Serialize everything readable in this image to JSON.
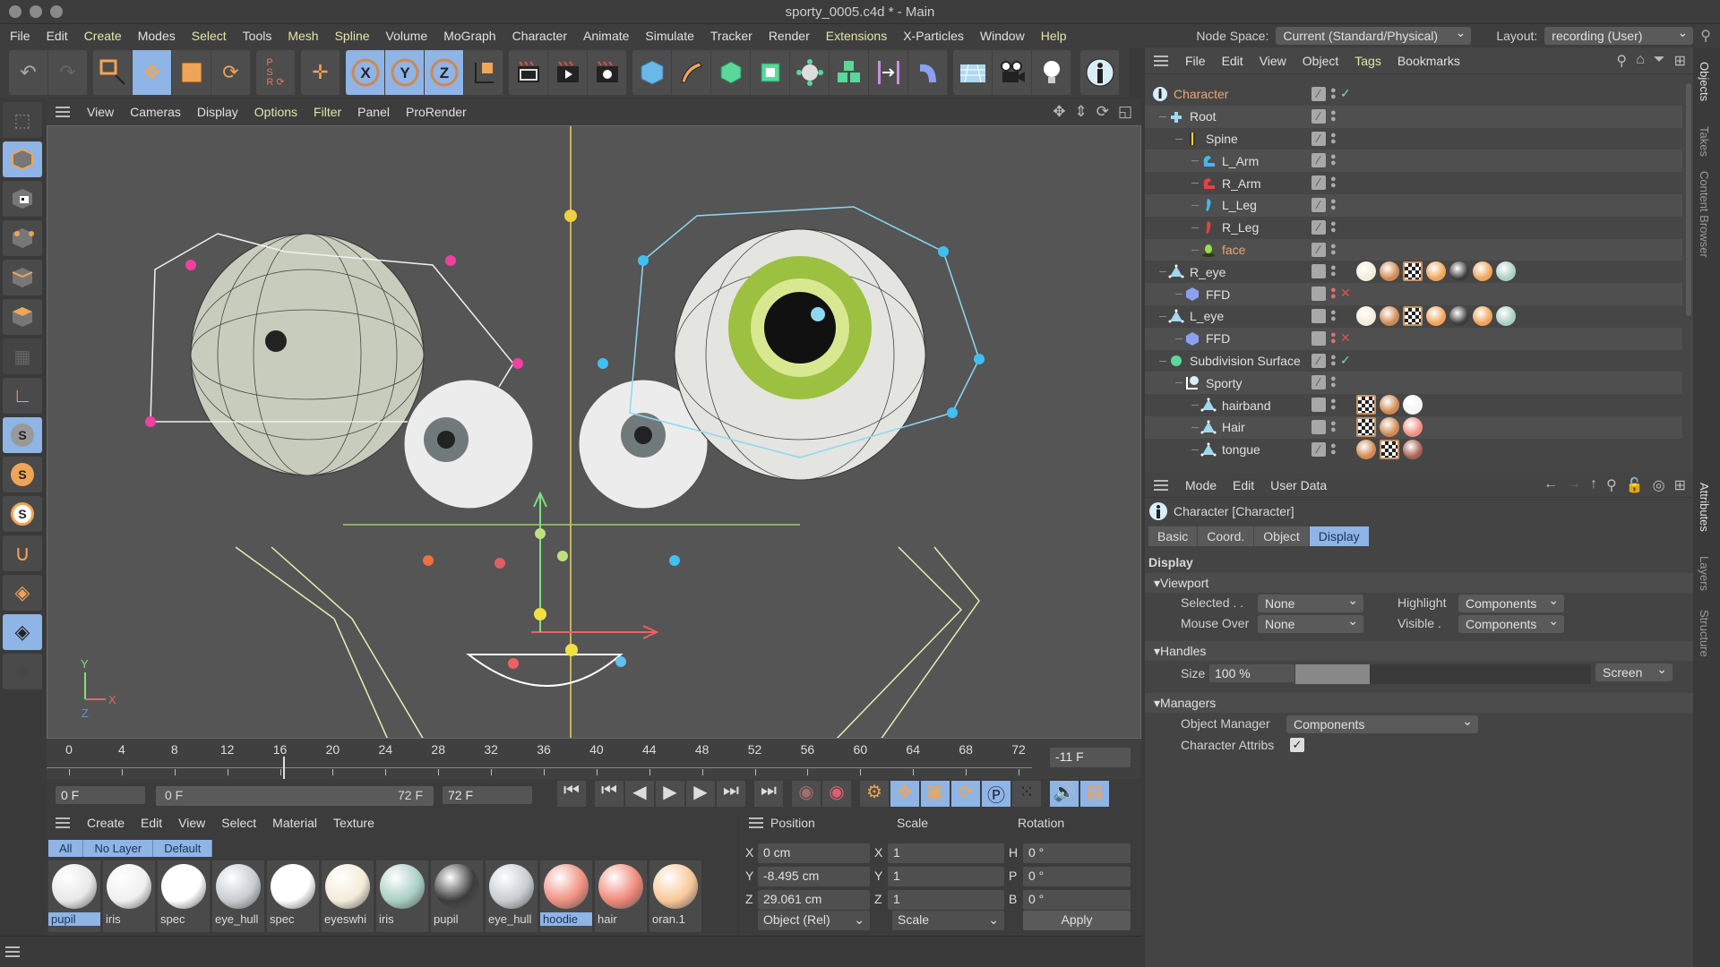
{
  "window": {
    "title": "sporty_0005.c4d * - Main"
  },
  "menubar": {
    "items": [
      {
        "label": "File",
        "hl": false
      },
      {
        "label": "Edit",
        "hl": false
      },
      {
        "label": "Create",
        "hl": true
      },
      {
        "label": "Modes",
        "hl": false
      },
      {
        "label": "Select",
        "hl": true
      },
      {
        "label": "Tools",
        "hl": false
      },
      {
        "label": "Mesh",
        "hl": true
      },
      {
        "label": "Spline",
        "hl": true
      },
      {
        "label": "Volume",
        "hl": false
      },
      {
        "label": "MoGraph",
        "hl": false
      },
      {
        "label": "Character",
        "hl": false
      },
      {
        "label": "Animate",
        "hl": false
      },
      {
        "label": "Simulate",
        "hl": false
      },
      {
        "label": "Tracker",
        "hl": false
      },
      {
        "label": "Render",
        "hl": false
      },
      {
        "label": "Extensions",
        "hl": true
      },
      {
        "label": "X-Particles",
        "hl": false
      },
      {
        "label": "Window",
        "hl": false
      },
      {
        "label": "Help",
        "hl": true
      }
    ],
    "node_space_label": "Node Space:",
    "node_space_value": "Current (Standard/Physical)",
    "layout_label": "Layout:",
    "layout_value": "recording (User)"
  },
  "toolbar": {
    "buttons": [
      "undo",
      "redo",
      "live-selection",
      "move",
      "scale",
      "rotate",
      "psr-reset",
      "coordinate-system",
      "x-axis-lock",
      "y-axis-lock",
      "z-axis-lock",
      "world-coordinates",
      "render-view",
      "render-picture-viewer",
      "render-settings",
      "cube",
      "pen",
      "subdivision",
      "extrude",
      "cloner",
      "array",
      "symmetry",
      "deformer",
      "floor",
      "camera",
      "light",
      "character"
    ],
    "axis_labels": [
      "X",
      "Y",
      "Z"
    ]
  },
  "viewport": {
    "menu": [
      "View",
      "Cameras",
      "Display",
      "Options",
      "Filter",
      "Panel",
      "ProRender"
    ],
    "menu_hl": [
      false,
      false,
      false,
      true,
      true,
      false,
      false
    ],
    "axis": {
      "x": "X",
      "y": "Y",
      "z": "Z"
    }
  },
  "timeline": {
    "ticks": [
      "0",
      "4",
      "8",
      "12",
      "16",
      "20",
      "24",
      "28",
      "32",
      "36",
      "40",
      "44",
      "48",
      "52",
      "56",
      "60",
      "64",
      "68",
      "72"
    ],
    "current_frame_readout": "-11 F",
    "start_field": "0 F",
    "range_start": "0 F",
    "range_end": "72 F",
    "end_field": "72 F"
  },
  "material_manager": {
    "menu": [
      "Create",
      "Edit",
      "View",
      "Select",
      "Material",
      "Texture"
    ],
    "filters": [
      "All",
      "No Layer",
      "Default"
    ],
    "materials": [
      {
        "name": "pupil",
        "color": "#e8e8e8",
        "selected": true
      },
      {
        "name": "iris",
        "color": "#f0f0f0",
        "selected": false
      },
      {
        "name": "spec",
        "color": "#ffffff",
        "selected": false
      },
      {
        "name": "eye_hull",
        "color": "#c8ccd0",
        "selected": false
      },
      {
        "name": "spec",
        "color": "#ffffff",
        "selected": false
      },
      {
        "name": "eyeswhi",
        "color": "#f4ecd8",
        "selected": false
      },
      {
        "name": "iris",
        "color": "#a8cfc4",
        "selected": false
      },
      {
        "name": "pupil",
        "color": "#3c3c3c",
        "selected": false
      },
      {
        "name": "eye_hull",
        "color": "#c8ccd0",
        "selected": false
      },
      {
        "name": "hoodie",
        "color": "#f09080",
        "selected": true
      },
      {
        "name": "hair",
        "color": "#f08878",
        "selected": false
      },
      {
        "name": "oran.1",
        "color": "#f8c898",
        "selected": false
      }
    ]
  },
  "coordinates": {
    "headers": [
      "Position",
      "Scale",
      "Rotation"
    ],
    "rows": [
      {
        "pos_axis": "X",
        "pos": "0 cm",
        "scale_axis": "X",
        "scale": "1",
        "rot_axis": "H",
        "rot": "0 °"
      },
      {
        "pos_axis": "Y",
        "pos": "-8.495 cm",
        "scale_axis": "Y",
        "scale": "1",
        "rot_axis": "P",
        "rot": "0 °"
      },
      {
        "pos_axis": "Z",
        "pos": "29.061 cm",
        "scale_axis": "Z",
        "scale": "1",
        "rot_axis": "B",
        "rot": "0 °"
      }
    ],
    "mode": "Object (Rel)",
    "scale_mode": "Scale",
    "apply_label": "Apply"
  },
  "object_manager": {
    "menu": [
      "File",
      "Edit",
      "View",
      "Object",
      "Tags",
      "Bookmarks"
    ],
    "menu_hl": [
      false,
      false,
      false,
      false,
      true,
      false
    ],
    "objects": [
      {
        "name": "Character",
        "depth": 0,
        "icon": "character",
        "color": "#e8a878",
        "vis": "check",
        "status": "check",
        "tags": []
      },
      {
        "name": "Root",
        "depth": 1,
        "icon": "joint-root",
        "color": "#e0e0e0",
        "vis": "edit",
        "status": "",
        "tags": []
      },
      {
        "name": "Spine",
        "depth": 2,
        "icon": "spine",
        "color": "#e0e0e0",
        "vis": "edit",
        "status": "",
        "tags": []
      },
      {
        "name": "L_Arm",
        "depth": 3,
        "icon": "arm-blue",
        "color": "#e0e0e0",
        "vis": "edit",
        "status": "",
        "tags": []
      },
      {
        "name": "R_Arm",
        "depth": 3,
        "icon": "arm-red",
        "color": "#e0e0e0",
        "vis": "edit",
        "status": "",
        "tags": []
      },
      {
        "name": "L_Leg",
        "depth": 3,
        "icon": "leg-blue",
        "color": "#e0e0e0",
        "vis": "edit",
        "status": "",
        "tags": []
      },
      {
        "name": "R_Leg",
        "depth": 3,
        "icon": "leg-red",
        "color": "#e0e0e0",
        "vis": "edit",
        "status": "",
        "tags": []
      },
      {
        "name": "face",
        "depth": 3,
        "icon": "face",
        "color": "#e8a878",
        "vis": "edit",
        "status": "",
        "tags": []
      },
      {
        "name": "R_eye",
        "depth": 1,
        "icon": "polygon",
        "color": "#e0e0e0",
        "vis": "",
        "status": "",
        "tags": [
          "#f4ecd8",
          "#d08850",
          "checker",
          "#f0a458",
          "#3c3c3c",
          "#f0a458",
          "#a8cfc4"
        ]
      },
      {
        "name": "FFD",
        "depth": 2,
        "icon": "ffd",
        "color": "#e0e0e0",
        "vis": "",
        "status": "x",
        "tags": []
      },
      {
        "name": "L_eye",
        "depth": 1,
        "icon": "polygon",
        "color": "#e0e0e0",
        "vis": "",
        "status": "",
        "tags": [
          "#f4ecd8",
          "#d08850",
          "checker",
          "#f0a458",
          "#3c3c3c",
          "#f0a458",
          "#a8cfc4"
        ]
      },
      {
        "name": "FFD",
        "depth": 2,
        "icon": "ffd",
        "color": "#e0e0e0",
        "vis": "",
        "status": "x",
        "tags": []
      },
      {
        "name": "Subdivision Surface",
        "depth": 1,
        "icon": "subdivision",
        "color": "#e0e0e0",
        "vis": "edit",
        "status": "check",
        "tags": []
      },
      {
        "name": "Sporty",
        "depth": 2,
        "icon": "null",
        "color": "#e0e0e0",
        "vis": "edit",
        "status": "",
        "tags": []
      },
      {
        "name": "hairband",
        "depth": 3,
        "icon": "polygon",
        "color": "#e0e0e0",
        "vis": "",
        "status": "",
        "tags": [
          "checker",
          "#d08850",
          "#f4f4f4"
        ]
      },
      {
        "name": "Hair",
        "depth": 3,
        "icon": "polygon",
        "color": "#e0e0e0",
        "vis": "",
        "status": "",
        "tags": [
          "checker",
          "#d08850",
          "#f09080"
        ]
      },
      {
        "name": "tongue",
        "depth": 3,
        "icon": "polygon",
        "color": "#e0e0e0",
        "vis": "edit",
        "status": "",
        "tags": [
          "#d08850",
          "checker",
          "#a86050"
        ]
      }
    ]
  },
  "attributes": {
    "menu": [
      "Mode",
      "Edit",
      "User Data"
    ],
    "object_title": "Character [Character]",
    "tabs": [
      {
        "label": "Basic",
        "active": false
      },
      {
        "label": "Coord.",
        "active": false
      },
      {
        "label": "Object",
        "active": false
      },
      {
        "label": "Display",
        "active": true
      }
    ],
    "section_title": "Display",
    "viewport_group": "Viewport",
    "selected_label": "Selected . .",
    "selected_value": "None",
    "highlight_label": "Highlight",
    "highlight_value": "Components",
    "mouseover_label": "Mouse Over",
    "mouseover_value": "None",
    "visible_label": "Visible .",
    "visible_value": "Components",
    "handles_group": "Handles",
    "size_label": "Size",
    "size_value": "100 %",
    "size_fraction": 0.25,
    "size_mode": "Screen",
    "managers_group": "Managers",
    "objmgr_label": "Object Manager",
    "objmgr_value": "Components",
    "charattr_label": "Character Attribs",
    "charattr_checked": true
  },
  "side_tabs": [
    {
      "label": "Objects",
      "active": true
    },
    {
      "label": "Takes",
      "active": false
    },
    {
      "label": "Content Browser",
      "active": false
    },
    {
      "label": "Attributes",
      "active": true
    },
    {
      "label": "Layers",
      "active": false
    },
    {
      "label": "Structure",
      "active": false
    }
  ],
  "colors": {
    "accent": "#8fb4e6",
    "highlight_text": "#e4e6a8",
    "object_orange": "#e8a878",
    "tool_orange": "#f0a458"
  }
}
